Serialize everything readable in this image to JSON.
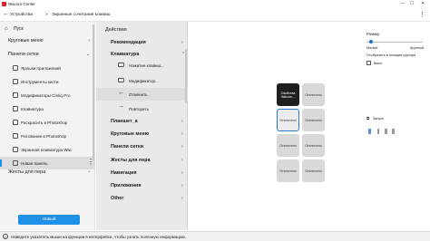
{
  "window": {
    "title": "Wacom Center"
  },
  "nav": {
    "devices": "Устройства",
    "separator": ">",
    "page": "Экранные сочетания клавиш"
  },
  "left": {
    "start": "Пуск",
    "items": [
      {
        "label": "Круговые меню"
      },
      {
        "label": "Панели сетки"
      },
      {
        "label": "Ярлыки приложений"
      },
      {
        "label": "Инструменты кисти"
      },
      {
        "label": "Модификаторы Cintiq Pro"
      },
      {
        "label": "Клавиатура"
      },
      {
        "label": "Раскрасить в Photoshop"
      },
      {
        "label": "Рисование в Photoshop"
      },
      {
        "label": "Экранная клавиатура Wac"
      },
      {
        "label": "Новая панель"
      },
      {
        "label": "Жесты для пера"
      }
    ],
    "new_button": "Новый"
  },
  "middle": {
    "header": "Действия",
    "items": [
      {
        "label": "Рекомендация"
      },
      {
        "label": "Клавиатура"
      },
      {
        "label": "Нажатие клавиш..."
      },
      {
        "label": "Модификатор..."
      },
      {
        "label": "Отменить"
      },
      {
        "label": "Повторить"
      },
      {
        "label": "Планшет_a"
      },
      {
        "label": "Круговые меню"
      },
      {
        "label": "Панели сетки"
      },
      {
        "label": "Жесты для пера"
      },
      {
        "label": "Навигация"
      },
      {
        "label": "Приложения"
      },
      {
        "label": "Other"
      }
    ]
  },
  "canvas": {
    "tiles": [
      {
        "label": "Свойства Wacom..."
      },
      {
        "label": "Отключено"
      },
      {
        "label": "Отключено"
      },
      {
        "label": "Отключено"
      },
      {
        "label": "Отключено"
      },
      {
        "label": "Отключено"
      },
      {
        "label": "Отключено"
      },
      {
        "label": "Отключено"
      }
    ]
  },
  "right": {
    "size_label": "Размер",
    "size_small": "Малый",
    "size_large": "Крупный",
    "size_value": 0.05,
    "show_at_cursor": "Отобразить в позиции курсора",
    "toggle": "Выкл.",
    "launch": "Запуск"
  },
  "status": {
    "text": "Наведите указатель мыши на функции в интерфейсе, чтобы узнать полезную информацию."
  },
  "colors": {
    "accent": "#1e90e6",
    "selection": "#2b7bd6",
    "dark_tile": "#1f1f1f"
  }
}
